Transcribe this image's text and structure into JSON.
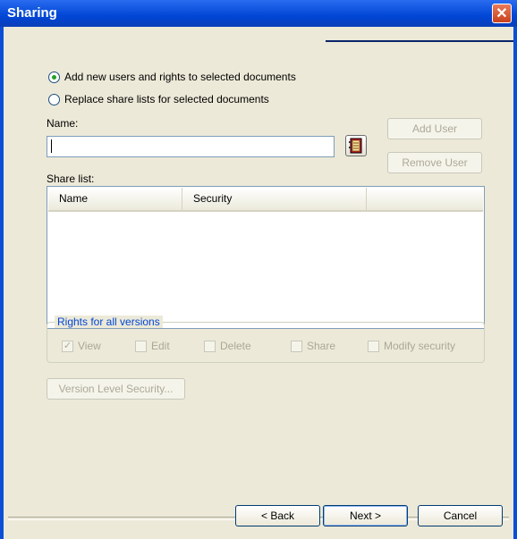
{
  "window": {
    "title": "Sharing",
    "close_glyph": "✕"
  },
  "mode_options": [
    {
      "label": "Add new users and rights to selected documents",
      "selected": true
    },
    {
      "label": "Replace share lists for selected documents",
      "selected": false
    }
  ],
  "name_field": {
    "label": "Name:",
    "value": ""
  },
  "buttons": {
    "add_user": "Add User",
    "remove_user": "Remove User",
    "version_security": "Version Level Security...",
    "back": "< Back",
    "next": "Next >",
    "cancel": "Cancel"
  },
  "share_list": {
    "label": "Share list:",
    "columns": [
      "Name",
      "Security"
    ],
    "rows": []
  },
  "rights": {
    "title": "Rights for all versions",
    "options": [
      {
        "label": "View",
        "checked": true
      },
      {
        "label": "Edit",
        "checked": false
      },
      {
        "label": "Delete",
        "checked": false
      },
      {
        "label": "Share",
        "checked": false
      },
      {
        "label": "Modify security",
        "checked": false
      }
    ]
  },
  "icons": {
    "address_book": "address-book-icon",
    "close": "close-icon"
  }
}
